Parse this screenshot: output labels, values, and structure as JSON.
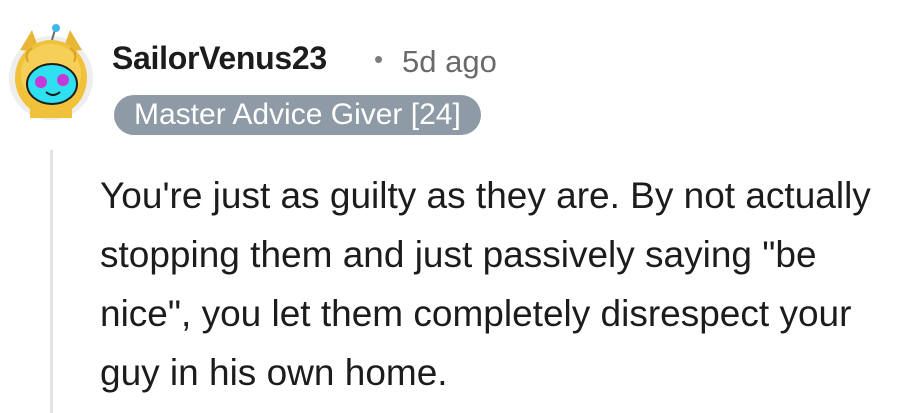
{
  "comment": {
    "author": "SailorVenus23",
    "separator": "•",
    "timestamp": "5d ago",
    "flair": "Master Advice Giver [24]",
    "body": "You're just as guilty as they are. By not actually stopping them and just passively saying \"be nice\", you let them completely disrespect your guy in his own home.",
    "avatar_icon": "snoo-avatar-yellow-hood-cyan-face"
  },
  "colors": {
    "flair_bg": "#8e9aa5",
    "text": "#1c1c1c",
    "meta": "#6a6a6a"
  }
}
